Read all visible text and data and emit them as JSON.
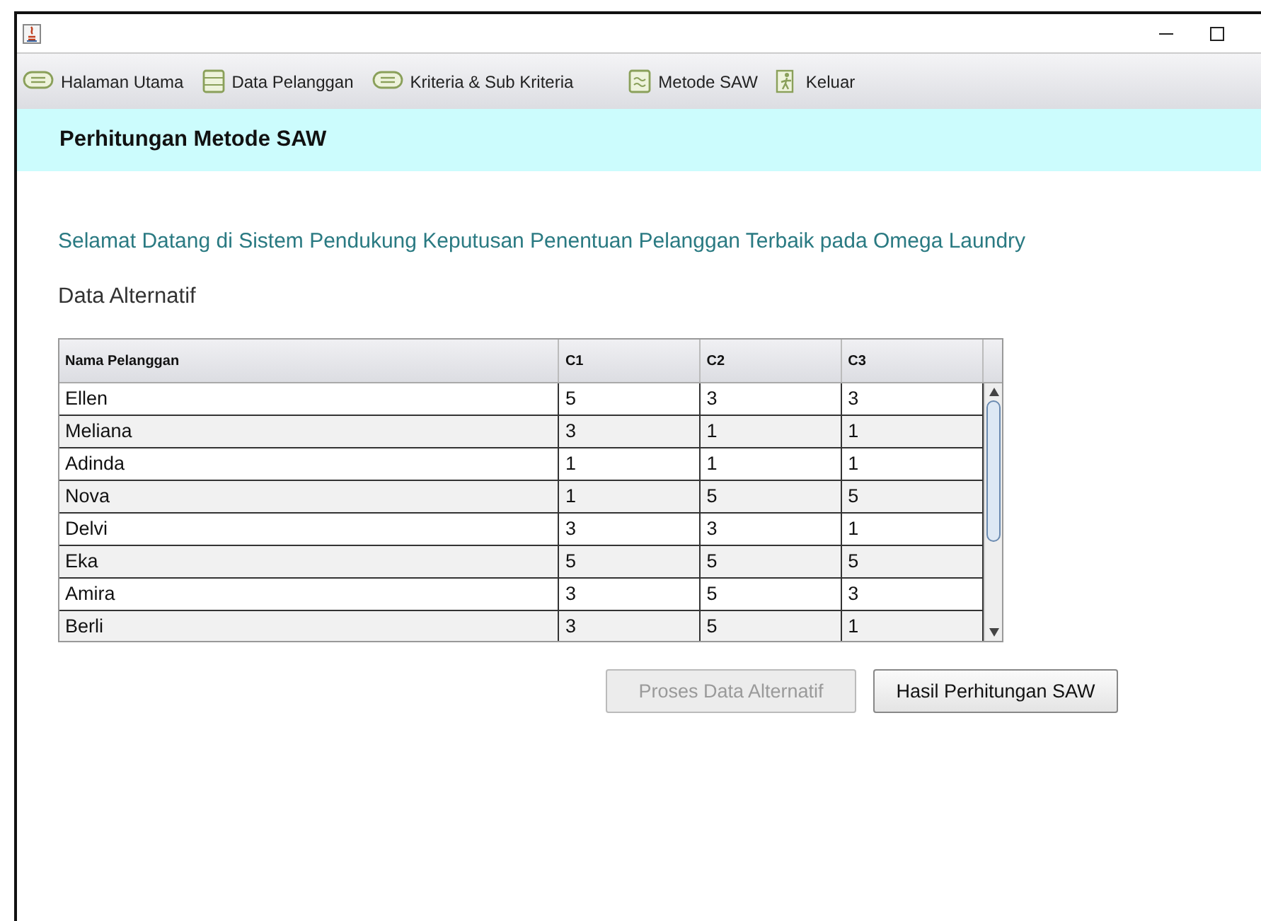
{
  "window": {
    "title_icon": true
  },
  "menu": [
    {
      "label": "Halaman Utama",
      "kind": "pill"
    },
    {
      "label": "Data Pelanggan",
      "kind": "list"
    },
    {
      "label": "Kriteria & Sub Kriteria",
      "kind": "pill"
    },
    {
      "label": "Metode SAW",
      "kind": "doc"
    },
    {
      "label": "Keluar",
      "kind": "exit"
    }
  ],
  "header": {
    "title": "Perhitungan Metode SAW"
  },
  "welcome": "Selamat Datang di Sistem Pendukung Keputusan Penentuan Pelanggan Terbaik pada Omega Laundry",
  "section_title": "Data Alternatif",
  "table": {
    "columns": [
      "Nama Pelanggan",
      "C1",
      "C2",
      "C3"
    ],
    "rows": [
      [
        "Ellen",
        "5",
        "3",
        "3"
      ],
      [
        "Meliana",
        "3",
        "1",
        "1"
      ],
      [
        "Adinda",
        "1",
        "1",
        "1"
      ],
      [
        "Nova",
        "1",
        "5",
        "5"
      ],
      [
        "Delvi",
        "3",
        "3",
        "1"
      ],
      [
        "Eka",
        "5",
        "5",
        "5"
      ],
      [
        "Amira",
        "3",
        "5",
        "3"
      ],
      [
        "Berli",
        "3",
        "5",
        "1"
      ]
    ]
  },
  "buttons": [
    {
      "label": "Proses Data Alternatif",
      "disabled": true
    },
    {
      "label": "Hasil Perhitungan SAW",
      "disabled": false
    }
  ]
}
